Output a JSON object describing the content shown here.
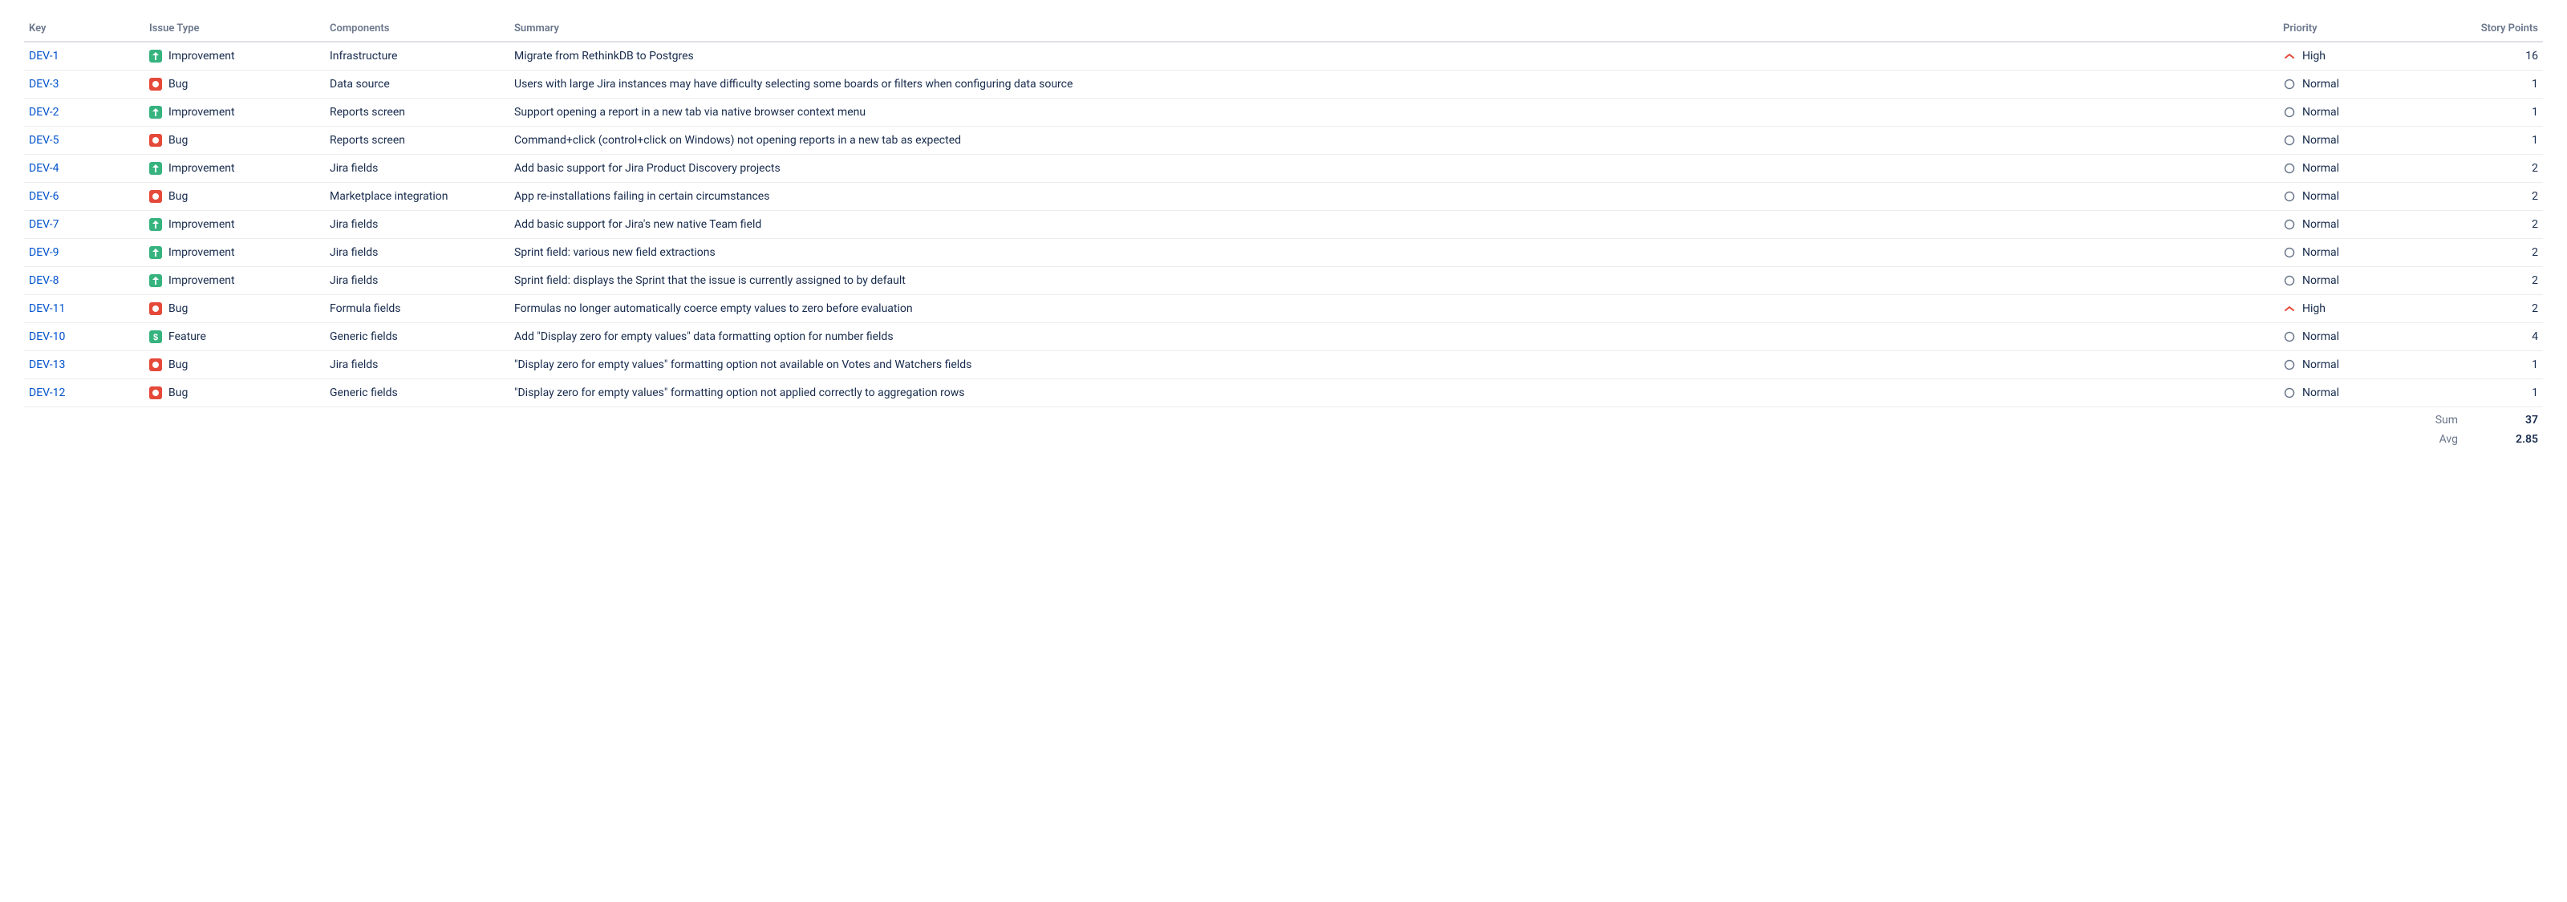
{
  "columns": {
    "key": "Key",
    "issueType": "Issue Type",
    "components": "Components",
    "summary": "Summary",
    "priority": "Priority",
    "storyPoints": "Story Points"
  },
  "issueTypes": {
    "improvement": "Improvement",
    "bug": "Bug",
    "feature": "Feature"
  },
  "priorities": {
    "high": "High",
    "normal": "Normal"
  },
  "rows": [
    {
      "key": "DEV-1",
      "type": "improvement",
      "components": "Infrastructure",
      "summary": "Migrate from RethinkDB to Postgres",
      "priority": "high",
      "sp": 16
    },
    {
      "key": "DEV-3",
      "type": "bug",
      "components": "Data source",
      "summary": "Users with large Jira instances may have difficulty selecting some boards or filters when configuring data source",
      "priority": "normal",
      "sp": 1
    },
    {
      "key": "DEV-2",
      "type": "improvement",
      "components": "Reports screen",
      "summary": "Support opening a report in a new tab via native browser context menu",
      "priority": "normal",
      "sp": 1
    },
    {
      "key": "DEV-5",
      "type": "bug",
      "components": "Reports screen",
      "summary": "Command+click (control+click on Windows) not opening reports in a new tab as expected",
      "priority": "normal",
      "sp": 1
    },
    {
      "key": "DEV-4",
      "type": "improvement",
      "components": "Jira fields",
      "summary": "Add basic support for Jira Product Discovery projects",
      "priority": "normal",
      "sp": 2
    },
    {
      "key": "DEV-6",
      "type": "bug",
      "components": "Marketplace integration",
      "summary": "App re-installations failing in certain circumstances",
      "priority": "normal",
      "sp": 2
    },
    {
      "key": "DEV-7",
      "type": "improvement",
      "components": "Jira fields",
      "summary": "Add basic support for Jira's new native Team field",
      "priority": "normal",
      "sp": 2
    },
    {
      "key": "DEV-9",
      "type": "improvement",
      "components": "Jira fields",
      "summary": "Sprint field: various new field extractions",
      "priority": "normal",
      "sp": 2
    },
    {
      "key": "DEV-8",
      "type": "improvement",
      "components": "Jira fields",
      "summary": "Sprint field: displays the Sprint that the issue is currently assigned to by default",
      "priority": "normal",
      "sp": 2
    },
    {
      "key": "DEV-11",
      "type": "bug",
      "components": "Formula fields",
      "summary": "Formulas no longer automatically coerce empty values to zero before evaluation",
      "priority": "high",
      "sp": 2
    },
    {
      "key": "DEV-10",
      "type": "feature",
      "components": "Generic fields",
      "summary": "Add \"Display zero for empty values\" data formatting option for number fields",
      "priority": "normal",
      "sp": 4
    },
    {
      "key": "DEV-13",
      "type": "bug",
      "components": "Jira fields",
      "summary": "\"Display zero for empty values\" formatting option not available on Votes and Watchers fields",
      "priority": "normal",
      "sp": 1
    },
    {
      "key": "DEV-12",
      "type": "bug",
      "components": "Generic fields",
      "summary": "\"Display zero for empty values\" formatting option not applied correctly to aggregation rows",
      "priority": "normal",
      "sp": 1
    }
  ],
  "footer": {
    "sumLabel": "Sum",
    "sumValue": "37",
    "avgLabel": "Avg",
    "avgValue": "2.85"
  }
}
